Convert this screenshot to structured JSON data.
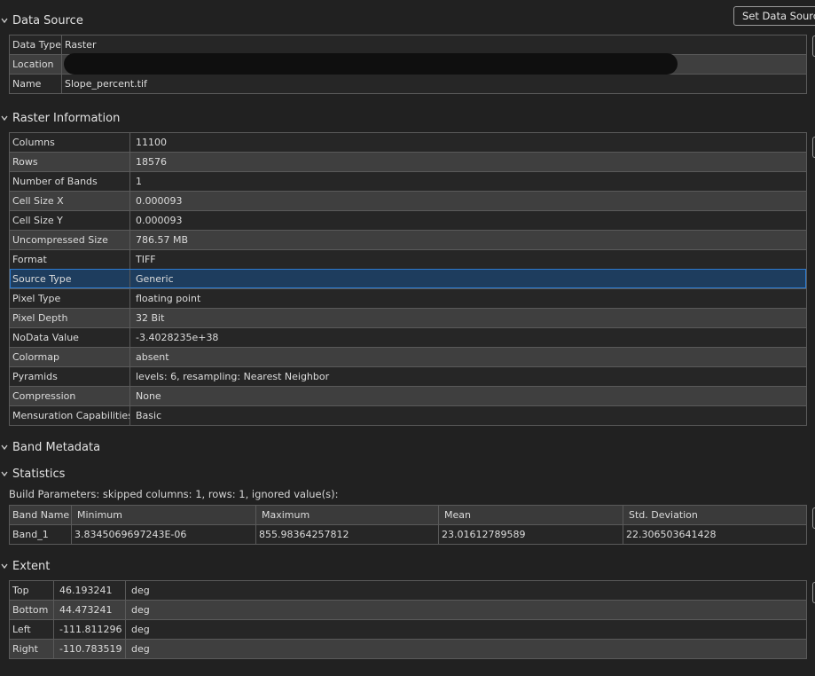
{
  "data_source": {
    "title": "Data Source",
    "set_button": "Set Data Source",
    "rows": [
      {
        "label": "Data Type",
        "value": "Raster"
      },
      {
        "label": "Location",
        "value": ""
      },
      {
        "label": "Name",
        "value": "Slope_percent.tif"
      }
    ]
  },
  "raster_info": {
    "title": "Raster Information",
    "rows": [
      {
        "label": "Columns",
        "value": "11100"
      },
      {
        "label": "Rows",
        "value": "18576"
      },
      {
        "label": "Number of Bands",
        "value": "1"
      },
      {
        "label": "Cell Size X",
        "value": "0.000093"
      },
      {
        "label": "Cell Size Y",
        "value": "0.000093"
      },
      {
        "label": "Uncompressed Size",
        "value": "786.57 MB"
      },
      {
        "label": "Format",
        "value": "TIFF"
      },
      {
        "label": "Source Type",
        "value": "Generic"
      },
      {
        "label": "Pixel Type",
        "value": "floating point"
      },
      {
        "label": "Pixel Depth",
        "value": "32 Bit"
      },
      {
        "label": "NoData Value",
        "value": "-3.4028235e+38"
      },
      {
        "label": "Colormap",
        "value": "absent"
      },
      {
        "label": "Pyramids",
        "value": "levels: 6, resampling: Nearest Neighbor"
      },
      {
        "label": "Compression",
        "value": "None"
      },
      {
        "label": "Mensuration Capabilities",
        "value": "Basic"
      }
    ],
    "selected_row": "Source Type"
  },
  "band_metadata": {
    "title": "Band Metadata"
  },
  "statistics": {
    "title": "Statistics",
    "build_parameters": "Build Parameters: skipped columns: 1, rows: 1, ignored value(s):",
    "headers": [
      "Band Name",
      "Minimum",
      "Maximum",
      "Mean",
      "Std. Deviation"
    ],
    "rows": [
      [
        "Band_1",
        "3.8345069697243E-06",
        "855.98364257812",
        "23.01612789589",
        "22.306503641428"
      ]
    ]
  },
  "extent": {
    "title": "Extent",
    "rows": [
      {
        "label": "Top",
        "value": "46.193241",
        "unit": "deg"
      },
      {
        "label": "Bottom",
        "value": "44.473241",
        "unit": "deg"
      },
      {
        "label": "Left",
        "value": "-111.811296",
        "unit": "deg"
      },
      {
        "label": "Right",
        "value": "-110.783519",
        "unit": "deg"
      }
    ]
  },
  "colors": {
    "background": "#212121",
    "row_alt": "#3f3f3f",
    "selection": "#1e3d5e",
    "selection_border": "#2d7bd0"
  }
}
